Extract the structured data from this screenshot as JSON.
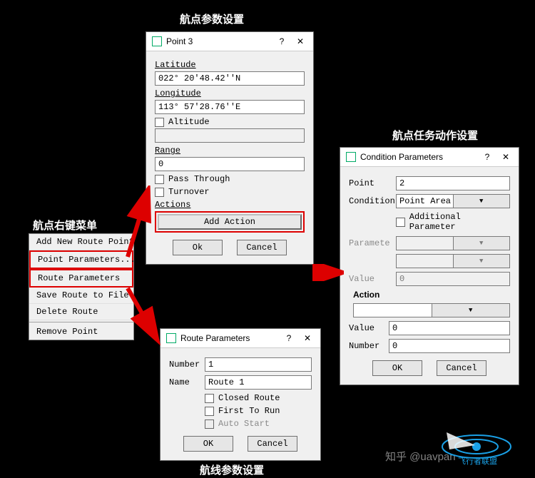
{
  "sections": {
    "waypoint_params": "航点参数设置",
    "context_menu": "航点右键菜单",
    "route_params": "航线参数设置",
    "condition_params": "航点任务动作设置"
  },
  "context_menu": {
    "items": {
      "i0": "Add New Route Point",
      "i1": "Point Parameters...",
      "i2": "Route Parameters",
      "i3": "Save Route to File",
      "i4": "Delete Route",
      "i5": "Remove Point"
    }
  },
  "point_dialog": {
    "title": "Point 3",
    "help": "?",
    "close": "✕",
    "lat_label": "Latitude",
    "lat_value": "022° 20′48.42′′N",
    "lon_label": "Longitude",
    "lon_value": "113° 57′28.76′′E",
    "alt_label": "Altitude",
    "alt_value": "",
    "range_label": "Range",
    "range_value": "0",
    "pass_label": "Pass Through",
    "turn_label": "Turnover",
    "actions_label": "Actions",
    "add_action": "Add Action",
    "ok": "Ok",
    "cancel": "Cancel"
  },
  "route_dialog": {
    "title": "Route Parameters",
    "help": "?",
    "close": "✕",
    "number_label": "Number",
    "number_value": "1",
    "name_label": "Name",
    "name_value": "Route 1",
    "closed_label": "Closed Route",
    "first_label": "First To Run",
    "auto_label": "Auto Start",
    "ok": "OK",
    "cancel": "Cancel"
  },
  "cond_dialog": {
    "title": "Condition Parameters",
    "help": "?",
    "close": "✕",
    "point_label": "Point",
    "point_value": "2",
    "condition_label": "Condition",
    "condition_value": "Point Area In",
    "addl_label": "Additional Parameter",
    "param_label": "Paramete",
    "param_value": "",
    "unnamed_value": "",
    "value_label": "Value",
    "value_value": "0",
    "action_label": "Action",
    "action_value": "",
    "value2_label": "Value",
    "value2_value": "0",
    "number_label": "Number",
    "number_value": "0",
    "ok": "OK",
    "cancel": "Cancel"
  },
  "watermark": {
    "zhihu": "知乎 @uavpan",
    "logo_line": "飞行者联盟"
  }
}
